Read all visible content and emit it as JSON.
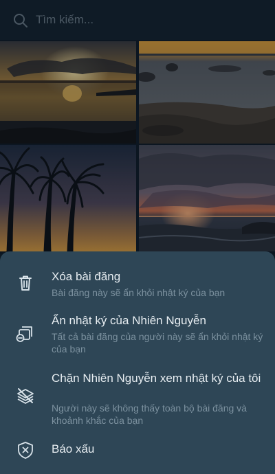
{
  "search": {
    "placeholder": "Tìm kiếm..."
  },
  "photos": [
    {
      "name": "sunset-over-bay"
    },
    {
      "name": "rocky-shore-sunset"
    },
    {
      "name": "palm-trees-silhouette"
    },
    {
      "name": "sea-sunset-clouds"
    }
  ],
  "menu": {
    "items": [
      {
        "icon": "trash-icon",
        "title": "Xóa bài đăng",
        "subtitle": "Bài đăng này sẽ ẩn khỏi nhật ký của bạn"
      },
      {
        "icon": "hide-timeline-icon",
        "title": "Ẩn nhật ký của Nhiên Nguyễn",
        "subtitle": "Tất cả bài đăng của người này sẽ ẩn khỏi nhật ký của bạn"
      },
      {
        "icon": "block-layers-icon",
        "title": "Chặn Nhiên Nguyễn xem nhật ký của tôi",
        "subtitle": "Người này sẽ không thấy toàn bộ bài đăng và khoảnh khắc của bạn"
      },
      {
        "icon": "report-shield-icon",
        "title": "Báo xấu",
        "subtitle": ""
      }
    ]
  }
}
